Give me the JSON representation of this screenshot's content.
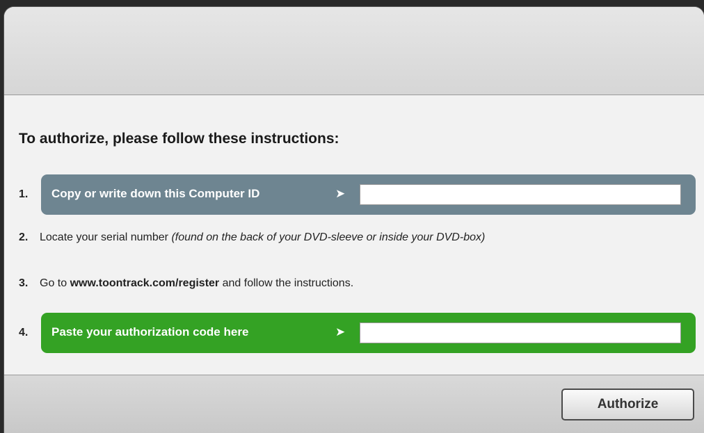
{
  "heading": "To authorize, please follow these instructions:",
  "steps": {
    "step1": {
      "number": "1.",
      "label": "Copy  or write down this Computer ID",
      "arrow": "➤",
      "field_value": ""
    },
    "step2": {
      "number": "2.",
      "text": "Locate your serial number ",
      "note": "(found on the back of your DVD-sleeve or inside your DVD-box)"
    },
    "step3": {
      "number": "3.",
      "prefix": "Go to ",
      "link": "www.toontrack.com/register",
      "suffix": " and follow the instructions."
    },
    "step4": {
      "number": "4.",
      "label": "Paste your authorization code here",
      "arrow": "➤",
      "field_value": ""
    }
  },
  "footer": {
    "authorize_label": "Authorize"
  },
  "colors": {
    "step1_bar": "#6e8591",
    "step4_bar": "#34a224",
    "background": "#f2f2f2"
  }
}
